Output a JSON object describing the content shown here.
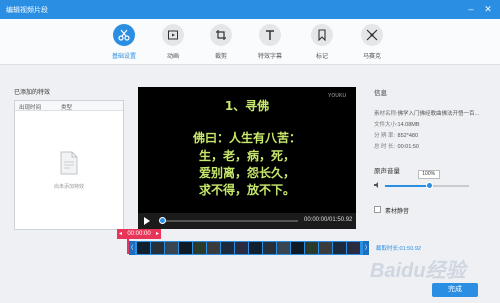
{
  "window": {
    "title": "编辑视频片段",
    "minimize": "–",
    "close": "✕"
  },
  "toolbar": {
    "tools": [
      {
        "label": "基础设置",
        "icon": "scissors-icon",
        "active": true
      },
      {
        "label": "动画",
        "icon": "animation-icon",
        "active": false
      },
      {
        "label": "裁剪",
        "icon": "crop-icon",
        "active": false
      },
      {
        "label": "特效字幕",
        "icon": "text-icon",
        "active": false
      },
      {
        "label": "标记",
        "icon": "bookmark-icon",
        "active": false
      },
      {
        "label": "马赛克",
        "icon": "mosaic-icon",
        "active": false
      }
    ]
  },
  "effects_panel": {
    "title": "已添加的特效",
    "columns": [
      "出现时间",
      "类型"
    ],
    "empty_text": "尚未添加特效"
  },
  "video": {
    "watermark": "YOUKU",
    "lines": [
      "1、寻佛",
      "佛曰：人生有八苦：",
      "生，老，病，死，",
      "爱别离，怨长久，",
      "求不得，放不下。"
    ],
    "time": "00:00:00/01:50.92",
    "progress": 0.0
  },
  "info": {
    "title": "信息",
    "rows": [
      {
        "key": "素材名称:",
        "value": "佛学入门佛经歌曲佛法开悟一百..."
      },
      {
        "key": "文件大小:",
        "value": "14.08MB"
      },
      {
        "key": "分 辨 率:",
        "value": "852*480"
      },
      {
        "key": "总 时 长:",
        "value": "00:01:50"
      }
    ],
    "volume_title": "原声音量",
    "volume_value": "100%",
    "volume_level": 0.52,
    "mute_label": "素材静音"
  },
  "timeline": {
    "current_time": "00:00:00",
    "cut_duration": "截取时长:01:50.92"
  },
  "footer": {
    "done_label": "完成"
  },
  "watermark": "Baidu经验",
  "colors": {
    "accent": "#2a8ee3",
    "marker": "#e8365a",
    "subtitle": "#c7e86a"
  }
}
